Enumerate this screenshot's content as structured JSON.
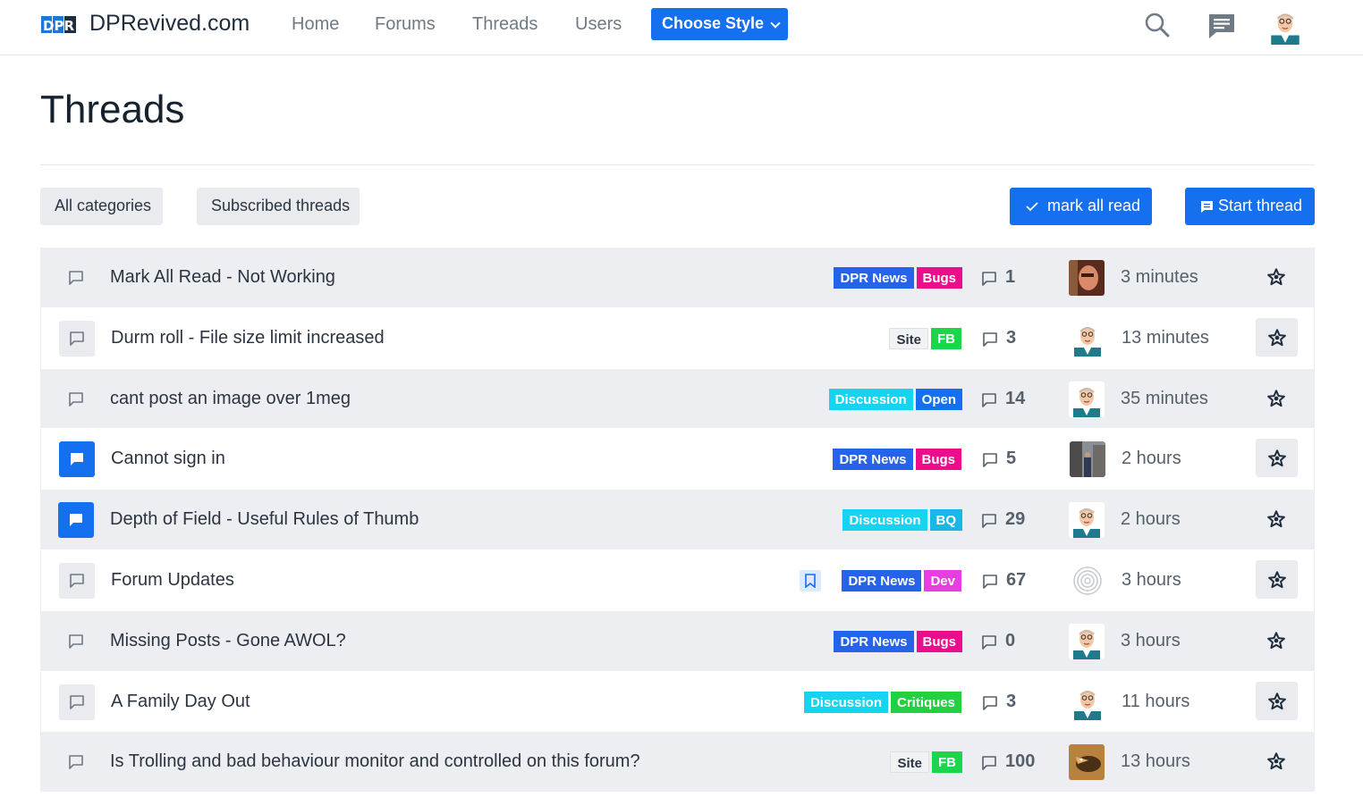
{
  "header": {
    "logo_text": "DPR",
    "brand": "DPRevived.com",
    "nav": [
      {
        "label": "Home"
      },
      {
        "label": "Forums"
      },
      {
        "label": "Threads"
      },
      {
        "label": "Users"
      }
    ],
    "choose_style_label": "Choose Style"
  },
  "page": {
    "title": "Threads"
  },
  "filters": {
    "all_categories": "All categories",
    "subscribed": "Subscribed threads",
    "mark_all_read": "mark all read",
    "start_thread": "Start thread"
  },
  "colors": {
    "accent": "#1570ef",
    "tag_dpr_news": "#2563eb",
    "tag_bugs": "#ec0c8c",
    "tag_discussion": "#16d3f0",
    "tag_open": "#1570ef",
    "tag_bq": "#18b7e8",
    "tag_dev": "#e83ee0",
    "tag_fb": "#19d64a",
    "tag_critiques": "#22d141"
  },
  "threads": [
    {
      "title": "Mark All Read - Not Working",
      "tags": [
        "DPR News",
        "Bugs"
      ],
      "replies": "1",
      "time": "3 minutes",
      "status": "read",
      "avatar": "photo-face"
    },
    {
      "title": "Durm roll - File size limit increased",
      "tags": [
        "Site",
        "FB"
      ],
      "replies": "3",
      "time": "13 minutes",
      "status": "read",
      "avatar": "cartoon-man"
    },
    {
      "title": "cant post an image over 1meg",
      "tags": [
        "Discussion",
        "Open"
      ],
      "replies": "14",
      "time": "35 minutes",
      "status": "read",
      "avatar": "cartoon-man"
    },
    {
      "title": "Cannot sign in",
      "tags": [
        "DPR News",
        "Bugs"
      ],
      "replies": "5",
      "time": "2 hours",
      "status": "unread",
      "avatar": "photo-street"
    },
    {
      "title": "Depth of Field - Useful Rules of Thumb",
      "tags": [
        "Discussion",
        "BQ"
      ],
      "replies": "29",
      "time": "2 hours",
      "status": "unread",
      "avatar": "cartoon-man"
    },
    {
      "title": "Forum Updates",
      "tags": [
        "DPR News",
        "Dev"
      ],
      "replies": "67",
      "time": "3 hours",
      "status": "read",
      "avatar": "fingerprint",
      "bookmarked": true
    },
    {
      "title": "Missing Posts - Gone AWOL?",
      "tags": [
        "DPR News",
        "Bugs"
      ],
      "replies": "0",
      "time": "3 hours",
      "status": "read",
      "avatar": "cartoon-man"
    },
    {
      "title": "A Family Day Out",
      "tags": [
        "Discussion",
        "Critiques"
      ],
      "replies": "3",
      "time": "11 hours",
      "status": "read",
      "avatar": "cartoon-man"
    },
    {
      "title": "Is Trolling and bad behaviour monitor and controlled on this forum?",
      "tags": [
        "Site",
        "FB"
      ],
      "replies": "100",
      "time": "13 hours",
      "status": "read",
      "avatar": "photo-bird"
    }
  ]
}
